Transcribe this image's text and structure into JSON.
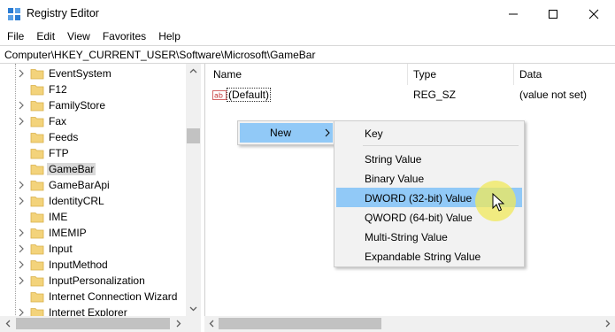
{
  "window": {
    "title": "Registry Editor",
    "controls": {
      "minimize": "minimize-icon",
      "maximize": "maximize-icon",
      "close": "close-icon"
    }
  },
  "menubar": [
    "File",
    "Edit",
    "View",
    "Favorites",
    "Help"
  ],
  "address": "Computer\\HKEY_CURRENT_USER\\Software\\Microsoft\\GameBar",
  "tree": [
    {
      "label": "EventSystem",
      "expandable": true
    },
    {
      "label": "F12",
      "expandable": false
    },
    {
      "label": "FamilyStore",
      "expandable": true
    },
    {
      "label": "Fax",
      "expandable": true
    },
    {
      "label": "Feeds",
      "expandable": false
    },
    {
      "label": "FTP",
      "expandable": false
    },
    {
      "label": "GameBar",
      "expandable": false,
      "selected": true
    },
    {
      "label": "GameBarApi",
      "expandable": true
    },
    {
      "label": "IdentityCRL",
      "expandable": true
    },
    {
      "label": "IME",
      "expandable": false
    },
    {
      "label": "IMEMIP",
      "expandable": true
    },
    {
      "label": "Input",
      "expandable": true
    },
    {
      "label": "InputMethod",
      "expandable": true
    },
    {
      "label": "InputPersonalization",
      "expandable": true
    },
    {
      "label": "Internet Connection Wizard",
      "expandable": false
    },
    {
      "label": "Internet Explorer",
      "expandable": true
    }
  ],
  "list": {
    "columns": {
      "name": "Name",
      "type": "Type",
      "data": "Data"
    },
    "rows": [
      {
        "name": "(Default)",
        "type": "REG_SZ",
        "data": "(value not set)",
        "icon": "string-value-icon"
      }
    ]
  },
  "context_menu": {
    "new_label": "New",
    "submenu": [
      {
        "label": "Key"
      },
      {
        "separator": true
      },
      {
        "label": "String Value"
      },
      {
        "label": "Binary Value"
      },
      {
        "label": "DWORD (32-bit) Value",
        "highlighted": true
      },
      {
        "label": "QWORD (64-bit) Value"
      },
      {
        "label": "Multi-String Value"
      },
      {
        "label": "Expandable String Value"
      }
    ]
  },
  "colors": {
    "highlight": "#91c9f7",
    "folder": "#f3d37b",
    "selected_tree": "#d9d9d9",
    "cursor_halo": "#f0e85a"
  }
}
